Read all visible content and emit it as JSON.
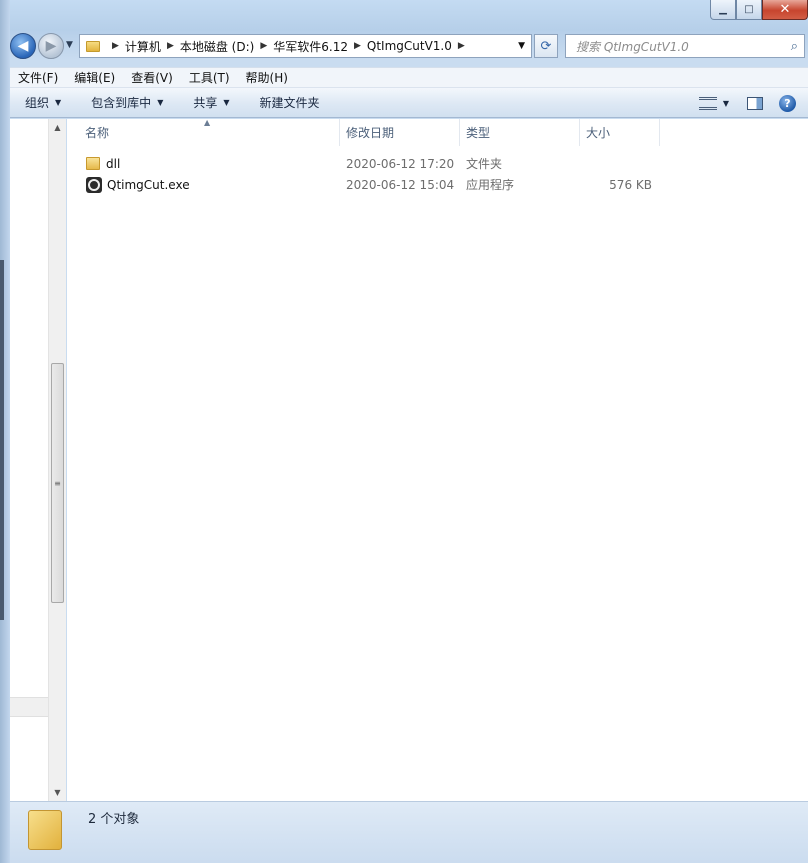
{
  "window": {
    "caption": {
      "minimize": "▁",
      "maximize": "□",
      "close": "✕"
    }
  },
  "nav": {
    "back_icon": "back-arrow-icon",
    "forward_icon": "forward-arrow-icon",
    "address": [
      "计算机",
      "本地磁盘 (D:)",
      "华军软件6.12",
      "QtImgCutV1.0"
    ],
    "search_placeholder": "搜索 QtImgCutV1.0"
  },
  "menubar": [
    "文件(F)",
    "编辑(E)",
    "查看(V)",
    "工具(T)",
    "帮助(H)"
  ],
  "commandbar": {
    "organize": "组织",
    "include_library": "包含到库中",
    "share": "共享",
    "new_folder": "新建文件夹"
  },
  "columns": {
    "name": "名称",
    "date": "修改日期",
    "type": "类型",
    "size": "大小"
  },
  "files": [
    {
      "name": "dll",
      "date": "2020-06-12 17:20",
      "type": "文件夹",
      "size": "",
      "icon": "folder-icon"
    },
    {
      "name": "QtimgCut.exe",
      "date": "2020-06-12 15:04",
      "type": "应用程序",
      "size": "576 KB",
      "icon": "exe-icon"
    }
  ],
  "status": {
    "count": "2 个对象"
  },
  "colors": {
    "accent": "#2a66b8",
    "close": "#c7452e",
    "window_frame": "#c9dcf0"
  }
}
